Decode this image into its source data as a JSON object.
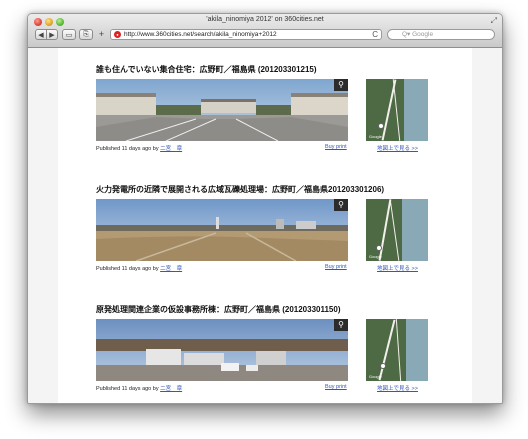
{
  "window": {
    "title": "'akila_ninomiya 2012' on 360cities.net"
  },
  "toolbar": {
    "back": "◀",
    "forward": "▶",
    "add": "+",
    "url": "http://www.360cities.net/search/akila_ninomiya+2012",
    "reload": "C",
    "search_placeholder": "Q▾ Google"
  },
  "posts": [
    {
      "title": "誰も住んでいない集合住宅：広野町／福島県 (201203301215)",
      "published": "Published 11 days ago by",
      "author": "二宮　章",
      "buy": "Buy print",
      "mapview": "地図上で見る >>"
    },
    {
      "title": "火力発電所の近隣で展開される広域瓦礫処理場：広野町／福島県201203301206)",
      "published": "Published 11 days ago by",
      "author": "二宮　章",
      "buy": "Buy print",
      "mapview": "地図上で見る >>"
    },
    {
      "title": "原発処理関連企業の仮設事務所棟：広野町／福島県 (201203301150)",
      "published": "Published 11 days ago by",
      "author": "二宮　章",
      "buy": "Buy print",
      "mapview": "地図上で見る >>"
    }
  ],
  "map_label": "Google",
  "colors": {
    "link": "#3358b5",
    "zoom_bg": "#2b2b2b"
  }
}
